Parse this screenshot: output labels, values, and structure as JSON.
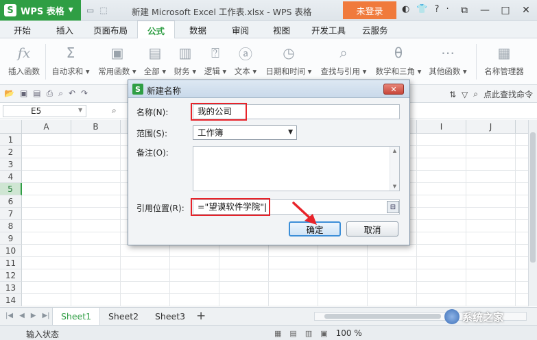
{
  "titlebar": {
    "app_name": "WPS 表格",
    "logo_letter": "S",
    "document_title": "新建 Microsoft Excel 工作表.xlsx - WPS 表格",
    "login_label": "未登录"
  },
  "menu": {
    "tabs": [
      {
        "label": "开始"
      },
      {
        "label": "插入"
      },
      {
        "label": "页面布局"
      },
      {
        "label": "公式"
      },
      {
        "label": "数据"
      },
      {
        "label": "审阅"
      },
      {
        "label": "视图"
      },
      {
        "label": "开发工具"
      },
      {
        "label": "云服务"
      }
    ],
    "active_tab": "公式"
  },
  "ribbon": {
    "buttons": [
      {
        "label": "插入函数",
        "icon": "fx-icon"
      },
      {
        "label": "自动求和",
        "icon": "sigma-icon"
      },
      {
        "label": "常用函数",
        "icon": "star-doc-icon"
      },
      {
        "label": "全部",
        "icon": "doc-icon"
      },
      {
        "label": "财务",
        "icon": "finance-icon"
      },
      {
        "label": "逻辑",
        "icon": "question-doc-icon"
      },
      {
        "label": "文本",
        "icon": "text-doc-icon"
      },
      {
        "label": "日期和时间",
        "icon": "clock-doc-icon"
      },
      {
        "label": "查找与引用",
        "icon": "search-doc-icon"
      },
      {
        "label": "数学和三角",
        "icon": "theta-doc-icon"
      },
      {
        "label": "其他函数",
        "icon": "dots-doc-icon"
      },
      {
        "label": "名称管理器",
        "icon": "name-manager-icon"
      }
    ]
  },
  "quick_toolbar": {
    "search_command_label": "点此查找命令"
  },
  "formula_bar": {
    "name_box": "E5"
  },
  "grid": {
    "columns": [
      "A",
      "B",
      "C",
      "D",
      "E",
      "F",
      "G",
      "H",
      "I",
      "J"
    ],
    "rows": [
      "1",
      "2",
      "3",
      "4",
      "5",
      "6",
      "7",
      "8",
      "9",
      "10",
      "11",
      "12",
      "13",
      "14"
    ],
    "selected_row": "5"
  },
  "sheets": {
    "tabs": [
      {
        "label": "Sheet1"
      },
      {
        "label": "Sheet2"
      },
      {
        "label": "Sheet3"
      }
    ],
    "active": "Sheet1",
    "add_label": "+"
  },
  "statusbar": {
    "mode": "输入状态",
    "zoom": "100 %"
  },
  "dialog": {
    "title": "新建名称",
    "name_label": "名称(N):",
    "name_value": "我的公司",
    "scope_label": "范围(S):",
    "scope_value": "工作簿",
    "comment_label": "备注(O):",
    "comment_value": "",
    "ref_label": "引用位置(R):",
    "ref_value": "=\"望谟软件学院\"|",
    "ok_label": "确定",
    "cancel_label": "取消"
  },
  "watermark": {
    "text": "系统之家"
  },
  "colors": {
    "brand_green": "#2f9e44",
    "login_orange": "#f07a3c",
    "highlight_red": "#e8232a"
  }
}
